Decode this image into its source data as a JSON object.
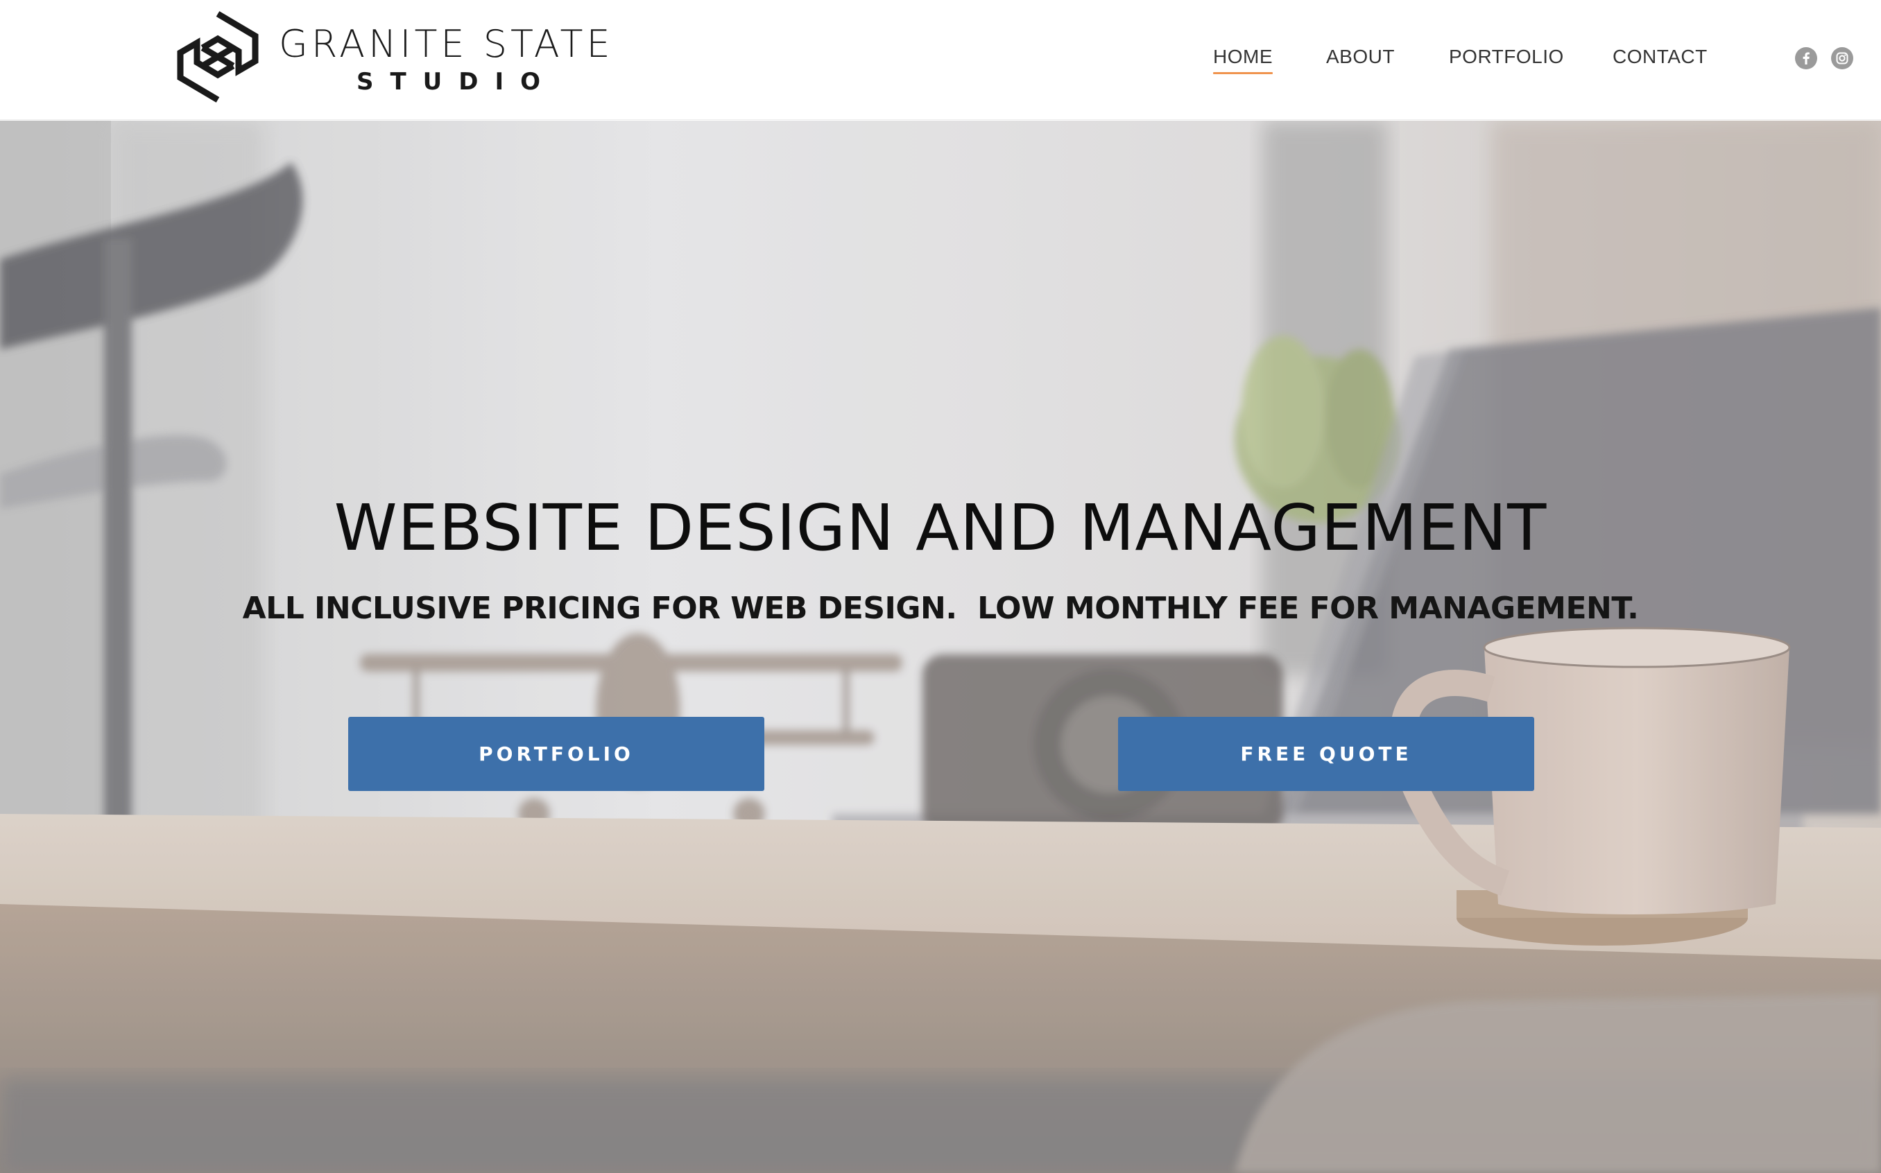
{
  "brand": {
    "title": "GRANITE STATE",
    "subtitle": "STUDIO",
    "logo_icon": "interlocking-s-logo-icon"
  },
  "nav": {
    "items": [
      {
        "label": "HOME",
        "active": true
      },
      {
        "label": "ABOUT",
        "active": false
      },
      {
        "label": "PORTFOLIO",
        "active": false
      },
      {
        "label": "CONTACT",
        "active": false
      }
    ],
    "active_underline_color": "#f0944e"
  },
  "social": {
    "icons": [
      "facebook-icon",
      "instagram-icon"
    ]
  },
  "hero": {
    "headline": "WEBSITE DESIGN AND MANAGEMENT",
    "subheadline": "ALL INCLUSIVE PRICING FOR WEB DESIGN.  LOW MONTHLY FEE FOR MANAGEMENT.",
    "background": "desk-with-laptop-coffee-mug-and-model-plane",
    "buttons": {
      "portfolio_label": "PORTFOLIO",
      "quote_label": "FREE QUOTE"
    },
    "button_color": "#3d70aa"
  }
}
